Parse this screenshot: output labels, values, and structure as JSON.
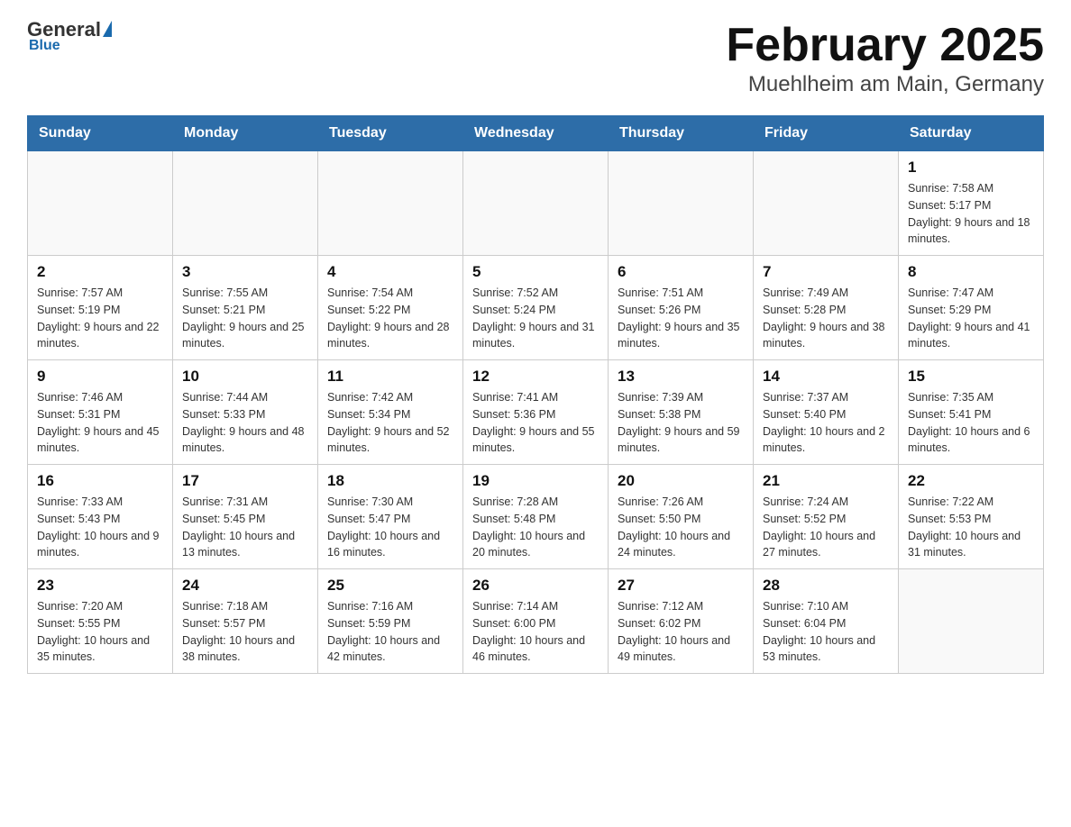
{
  "header": {
    "logo_general": "General",
    "logo_blue": "Blue",
    "title": "February 2025",
    "subtitle": "Muehlheim am Main, Germany"
  },
  "weekdays": [
    "Sunday",
    "Monday",
    "Tuesday",
    "Wednesday",
    "Thursday",
    "Friday",
    "Saturday"
  ],
  "weeks": [
    [
      {
        "day": "",
        "info": ""
      },
      {
        "day": "",
        "info": ""
      },
      {
        "day": "",
        "info": ""
      },
      {
        "day": "",
        "info": ""
      },
      {
        "day": "",
        "info": ""
      },
      {
        "day": "",
        "info": ""
      },
      {
        "day": "1",
        "info": "Sunrise: 7:58 AM\nSunset: 5:17 PM\nDaylight: 9 hours and 18 minutes."
      }
    ],
    [
      {
        "day": "2",
        "info": "Sunrise: 7:57 AM\nSunset: 5:19 PM\nDaylight: 9 hours and 22 minutes."
      },
      {
        "day": "3",
        "info": "Sunrise: 7:55 AM\nSunset: 5:21 PM\nDaylight: 9 hours and 25 minutes."
      },
      {
        "day": "4",
        "info": "Sunrise: 7:54 AM\nSunset: 5:22 PM\nDaylight: 9 hours and 28 minutes."
      },
      {
        "day": "5",
        "info": "Sunrise: 7:52 AM\nSunset: 5:24 PM\nDaylight: 9 hours and 31 minutes."
      },
      {
        "day": "6",
        "info": "Sunrise: 7:51 AM\nSunset: 5:26 PM\nDaylight: 9 hours and 35 minutes."
      },
      {
        "day": "7",
        "info": "Sunrise: 7:49 AM\nSunset: 5:28 PM\nDaylight: 9 hours and 38 minutes."
      },
      {
        "day": "8",
        "info": "Sunrise: 7:47 AM\nSunset: 5:29 PM\nDaylight: 9 hours and 41 minutes."
      }
    ],
    [
      {
        "day": "9",
        "info": "Sunrise: 7:46 AM\nSunset: 5:31 PM\nDaylight: 9 hours and 45 minutes."
      },
      {
        "day": "10",
        "info": "Sunrise: 7:44 AM\nSunset: 5:33 PM\nDaylight: 9 hours and 48 minutes."
      },
      {
        "day": "11",
        "info": "Sunrise: 7:42 AM\nSunset: 5:34 PM\nDaylight: 9 hours and 52 minutes."
      },
      {
        "day": "12",
        "info": "Sunrise: 7:41 AM\nSunset: 5:36 PM\nDaylight: 9 hours and 55 minutes."
      },
      {
        "day": "13",
        "info": "Sunrise: 7:39 AM\nSunset: 5:38 PM\nDaylight: 9 hours and 59 minutes."
      },
      {
        "day": "14",
        "info": "Sunrise: 7:37 AM\nSunset: 5:40 PM\nDaylight: 10 hours and 2 minutes."
      },
      {
        "day": "15",
        "info": "Sunrise: 7:35 AM\nSunset: 5:41 PM\nDaylight: 10 hours and 6 minutes."
      }
    ],
    [
      {
        "day": "16",
        "info": "Sunrise: 7:33 AM\nSunset: 5:43 PM\nDaylight: 10 hours and 9 minutes."
      },
      {
        "day": "17",
        "info": "Sunrise: 7:31 AM\nSunset: 5:45 PM\nDaylight: 10 hours and 13 minutes."
      },
      {
        "day": "18",
        "info": "Sunrise: 7:30 AM\nSunset: 5:47 PM\nDaylight: 10 hours and 16 minutes."
      },
      {
        "day": "19",
        "info": "Sunrise: 7:28 AM\nSunset: 5:48 PM\nDaylight: 10 hours and 20 minutes."
      },
      {
        "day": "20",
        "info": "Sunrise: 7:26 AM\nSunset: 5:50 PM\nDaylight: 10 hours and 24 minutes."
      },
      {
        "day": "21",
        "info": "Sunrise: 7:24 AM\nSunset: 5:52 PM\nDaylight: 10 hours and 27 minutes."
      },
      {
        "day": "22",
        "info": "Sunrise: 7:22 AM\nSunset: 5:53 PM\nDaylight: 10 hours and 31 minutes."
      }
    ],
    [
      {
        "day": "23",
        "info": "Sunrise: 7:20 AM\nSunset: 5:55 PM\nDaylight: 10 hours and 35 minutes."
      },
      {
        "day": "24",
        "info": "Sunrise: 7:18 AM\nSunset: 5:57 PM\nDaylight: 10 hours and 38 minutes."
      },
      {
        "day": "25",
        "info": "Sunrise: 7:16 AM\nSunset: 5:59 PM\nDaylight: 10 hours and 42 minutes."
      },
      {
        "day": "26",
        "info": "Sunrise: 7:14 AM\nSunset: 6:00 PM\nDaylight: 10 hours and 46 minutes."
      },
      {
        "day": "27",
        "info": "Sunrise: 7:12 AM\nSunset: 6:02 PM\nDaylight: 10 hours and 49 minutes."
      },
      {
        "day": "28",
        "info": "Sunrise: 7:10 AM\nSunset: 6:04 PM\nDaylight: 10 hours and 53 minutes."
      },
      {
        "day": "",
        "info": ""
      }
    ]
  ]
}
